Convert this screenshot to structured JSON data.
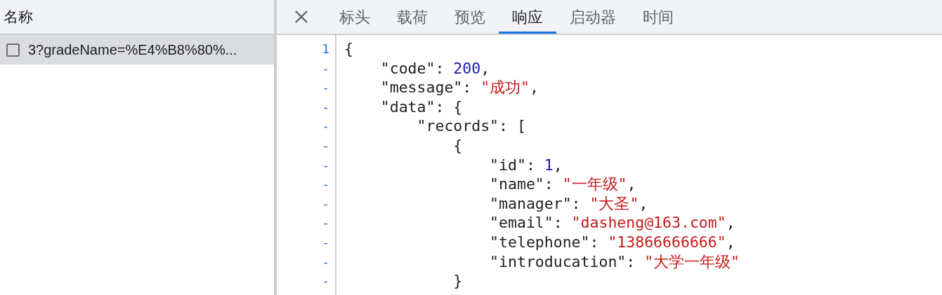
{
  "requests_panel": {
    "header": "名称",
    "rows": [
      {
        "name": "3?gradeName=%E4%B8%80%...",
        "selected": true
      }
    ]
  },
  "tabs": [
    {
      "label": "标头",
      "selected": false
    },
    {
      "label": "载荷",
      "selected": false
    },
    {
      "label": "预览",
      "selected": false
    },
    {
      "label": "响应",
      "selected": true
    },
    {
      "label": "启动器",
      "selected": false
    },
    {
      "label": "时间",
      "selected": false
    }
  ],
  "response": {
    "lines": [
      {
        "gutter": "1",
        "tokens": [
          {
            "kind": "punct",
            "text": "{"
          }
        ]
      },
      {
        "gutter": "-",
        "tokens": [
          {
            "kind": "key",
            "text": "    \"code\": "
          },
          {
            "kind": "number",
            "text": "200"
          },
          {
            "kind": "punct",
            "text": ","
          }
        ]
      },
      {
        "gutter": "-",
        "tokens": [
          {
            "kind": "key",
            "text": "    \"message\": "
          },
          {
            "kind": "string",
            "text": "\"成功\""
          },
          {
            "kind": "punct",
            "text": ","
          }
        ]
      },
      {
        "gutter": "-",
        "tokens": [
          {
            "kind": "key",
            "text": "    \"data\": {"
          }
        ]
      },
      {
        "gutter": "-",
        "tokens": [
          {
            "kind": "key",
            "text": "        \"records\": ["
          }
        ]
      },
      {
        "gutter": "-",
        "tokens": [
          {
            "kind": "punct",
            "text": "            {"
          }
        ]
      },
      {
        "gutter": "-",
        "tokens": [
          {
            "kind": "key",
            "text": "                \"id\": "
          },
          {
            "kind": "number",
            "text": "1"
          },
          {
            "kind": "punct",
            "text": ","
          }
        ]
      },
      {
        "gutter": "-",
        "tokens": [
          {
            "kind": "key",
            "text": "                \"name\": "
          },
          {
            "kind": "string",
            "text": "\"一年级\""
          },
          {
            "kind": "punct",
            "text": ","
          }
        ]
      },
      {
        "gutter": "-",
        "tokens": [
          {
            "kind": "key",
            "text": "                \"manager\": "
          },
          {
            "kind": "string",
            "text": "\"大圣\""
          },
          {
            "kind": "punct",
            "text": ","
          }
        ]
      },
      {
        "gutter": "-",
        "tokens": [
          {
            "kind": "key",
            "text": "                \"email\": "
          },
          {
            "kind": "string",
            "text": "\"dasheng@163.com\""
          },
          {
            "kind": "punct",
            "text": ","
          }
        ]
      },
      {
        "gutter": "-",
        "tokens": [
          {
            "kind": "key",
            "text": "                \"telephone\": "
          },
          {
            "kind": "string",
            "text": "\"13866666666\""
          },
          {
            "kind": "punct",
            "text": ","
          }
        ]
      },
      {
        "gutter": "-",
        "tokens": [
          {
            "kind": "key",
            "text": "                \"introducation\": "
          },
          {
            "kind": "string",
            "text": "\"大学一年级\""
          }
        ]
      },
      {
        "gutter": "-",
        "tokens": [
          {
            "kind": "punct",
            "text": "            }"
          }
        ]
      }
    ]
  }
}
